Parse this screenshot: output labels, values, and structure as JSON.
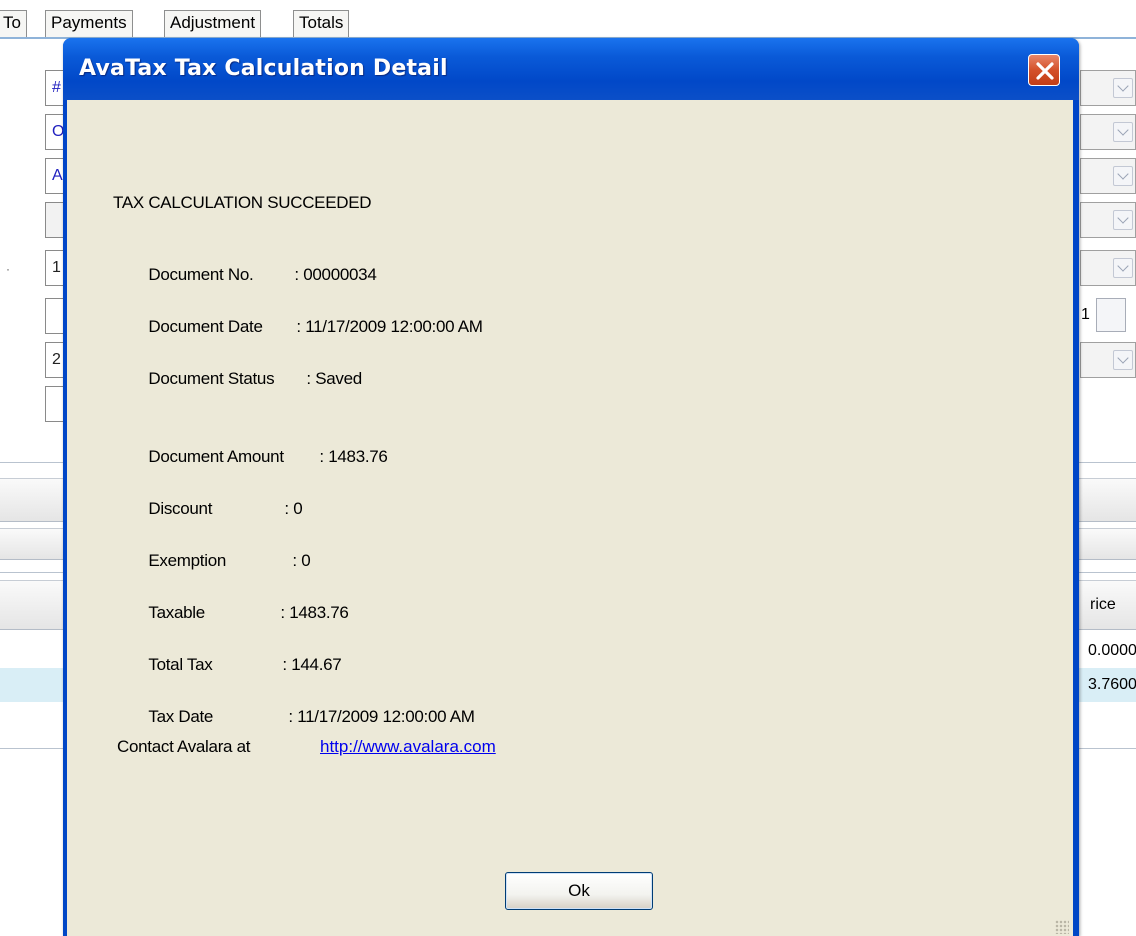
{
  "background": {
    "tabs": [
      "To",
      "Payments",
      "Adjustment",
      "Totals"
    ],
    "left_fields": [
      "#",
      "O",
      "A",
      "",
      "1",
      "",
      "2",
      ""
    ],
    "spin_value": "1",
    "column_header": "rice",
    "rows": [
      "0.0000",
      "3.7600"
    ]
  },
  "dialog": {
    "title": "AvaTax Tax Calculation Detail",
    "heading": "TAX CALCULATION SUCCEEDED",
    "fields": [
      {
        "label": "Document No.",
        "value": ": 00000034"
      },
      {
        "label": "Document Date",
        "value": ": 11/17/2009 12:00:00 AM"
      },
      {
        "label": "Document Status",
        "value": ": Saved"
      },
      {
        "label": "Document Amount",
        "value": ": 1483.76"
      },
      {
        "label": "Discount",
        "value": ": 0"
      },
      {
        "label": "Exemption",
        "value": ": 0"
      },
      {
        "label": "Taxable",
        "value": ": 1483.76"
      },
      {
        "label": "Total Tax",
        "value": ": 144.67"
      },
      {
        "label": "Tax Date",
        "value": ": 11/17/2009 12:00:00 AM"
      }
    ],
    "contact_label": "Contact Avalara at",
    "contact_link": "http://www.avalara.com",
    "ok_label": "Ok"
  },
  "colors": {
    "title_bar": "#0148c8",
    "client_bg": "#ece9d8",
    "link": "#0000ee",
    "close_button": "#d4512a"
  },
  "icons": [
    "close-icon",
    "chevron-down-icon",
    "spin-up-down-icon",
    "resize-grip-icon"
  ]
}
